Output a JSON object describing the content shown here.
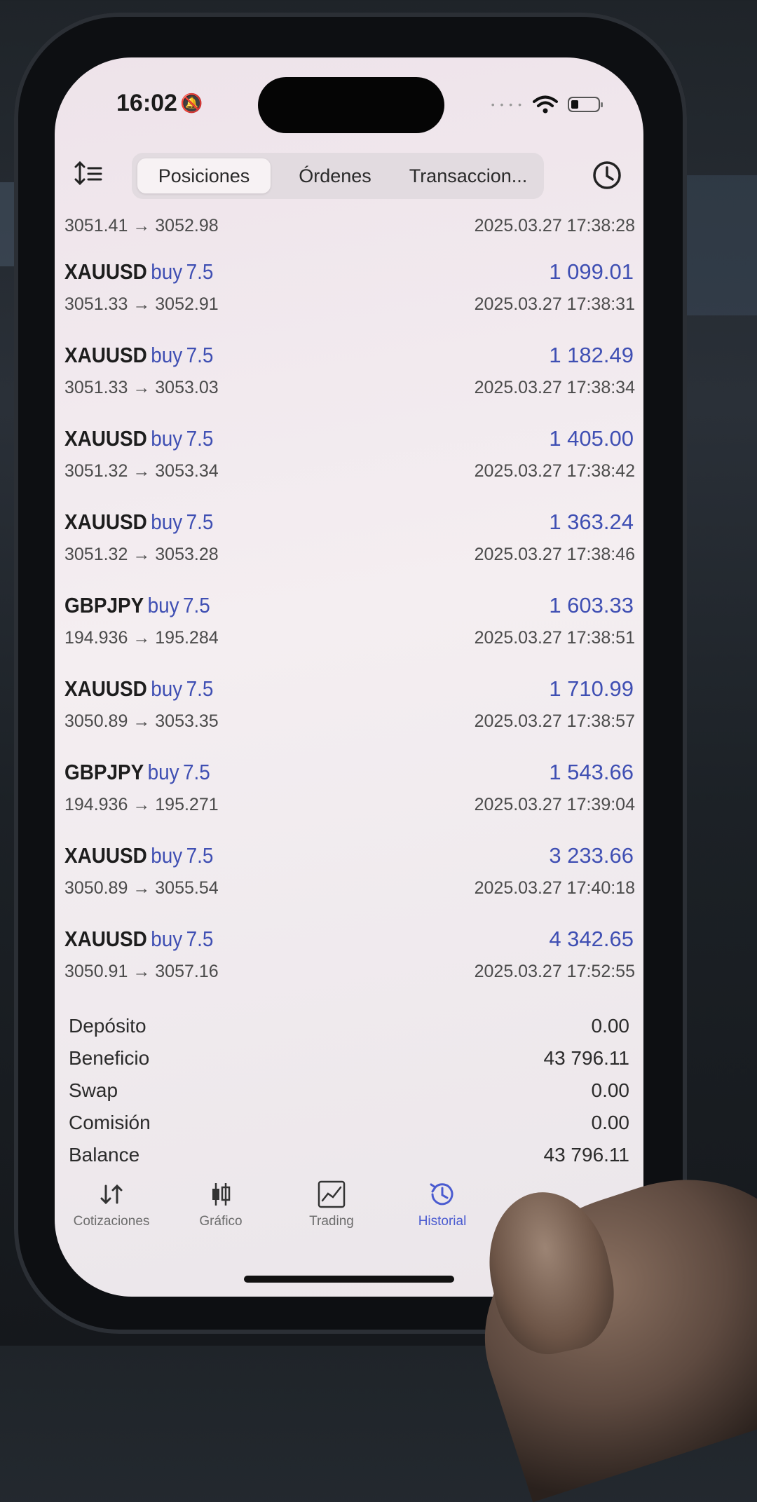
{
  "status_bar": {
    "time": "16:02"
  },
  "tabs": {
    "positions": "Posiciones",
    "orders": "Órdenes",
    "transactions": "Transaccion..."
  },
  "partial_row": {
    "prices": "3051.41 → 3052.98",
    "time": "2025.03.27 17:38:28"
  },
  "trades": [
    {
      "symbol": "XAUUSD",
      "type": "buy",
      "volume": "7.5",
      "profit": "1 099.01",
      "prices": "3051.33 → 3052.91",
      "time": "2025.03.27 17:38:31"
    },
    {
      "symbol": "XAUUSD",
      "type": "buy",
      "volume": "7.5",
      "profit": "1 182.49",
      "prices": "3051.33 → 3053.03",
      "time": "2025.03.27 17:38:34"
    },
    {
      "symbol": "XAUUSD",
      "type": "buy",
      "volume": "7.5",
      "profit": "1 405.00",
      "prices": "3051.32 → 3053.34",
      "time": "2025.03.27 17:38:42"
    },
    {
      "symbol": "XAUUSD",
      "type": "buy",
      "volume": "7.5",
      "profit": "1 363.24",
      "prices": "3051.32 → 3053.28",
      "time": "2025.03.27 17:38:46"
    },
    {
      "symbol": "GBPJPY",
      "type": "buy",
      "volume": "7.5",
      "profit": "1 603.33",
      "prices": "194.936 → 195.284",
      "time": "2025.03.27 17:38:51"
    },
    {
      "symbol": "XAUUSD",
      "type": "buy",
      "volume": "7.5",
      "profit": "1 710.99",
      "prices": "3050.89 → 3053.35",
      "time": "2025.03.27 17:38:57"
    },
    {
      "symbol": "GBPJPY",
      "type": "buy",
      "volume": "7.5",
      "profit": "1 543.66",
      "prices": "194.936 → 195.271",
      "time": "2025.03.27 17:39:04"
    },
    {
      "symbol": "XAUUSD",
      "type": "buy",
      "volume": "7.5",
      "profit": "3 233.66",
      "prices": "3050.89 → 3055.54",
      "time": "2025.03.27 17:40:18"
    },
    {
      "symbol": "XAUUSD",
      "type": "buy",
      "volume": "7.5",
      "profit": "4 342.65",
      "prices": "3050.91 → 3057.16",
      "time": "2025.03.27 17:52:55"
    }
  ],
  "summary": [
    {
      "label": "Depósito",
      "value": "0.00"
    },
    {
      "label": "Beneficio",
      "value": "43 796.11"
    },
    {
      "label": "Swap",
      "value": "0.00"
    },
    {
      "label": "Comisión",
      "value": "0.00"
    },
    {
      "label": "Balance",
      "value": "43 796.11"
    }
  ],
  "bottom_nav": [
    {
      "label": "Cotizaciones",
      "icon": "quotes-arrows-icon"
    },
    {
      "label": "Gráfico",
      "icon": "candlestick-icon"
    },
    {
      "label": "Trading",
      "icon": "trading-chart-icon"
    },
    {
      "label": "Historial",
      "icon": "history-clock-icon",
      "active": true
    }
  ],
  "colors": {
    "accent": "#3f4fb3",
    "active_tab": "#4a5bd0",
    "screen_bg": "#f1ebee"
  }
}
